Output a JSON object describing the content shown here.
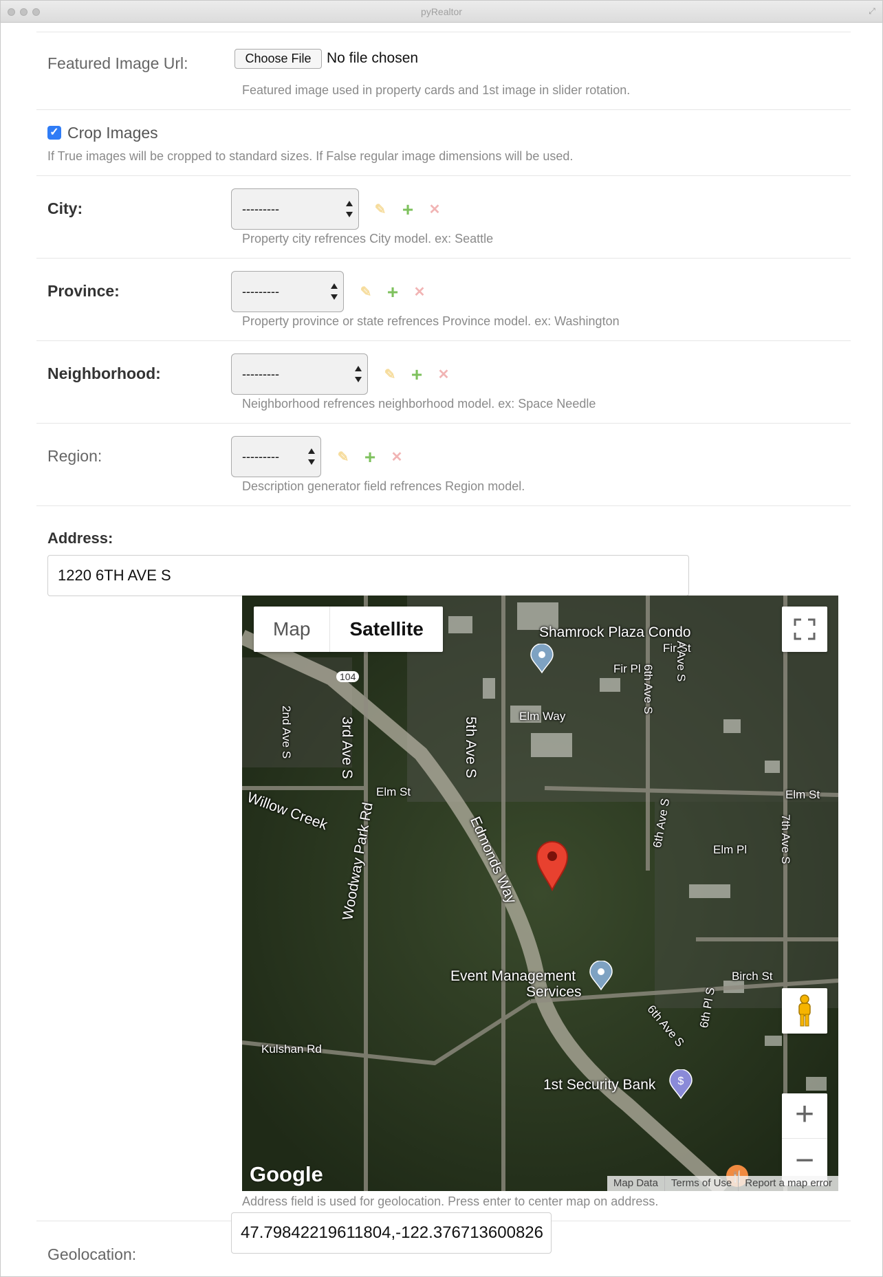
{
  "window": {
    "title": "pyRealtor"
  },
  "featured_image": {
    "label": "Featured Image Url:",
    "choose_button": "Choose File",
    "file_status": "No file chosen",
    "help": "Featured image used in property cards and 1st image in slider rotation."
  },
  "crop_images": {
    "label": "Crop Images",
    "checked": true,
    "help": "If True images will be cropped to standard sizes. If False regular image dimensions will be used."
  },
  "city": {
    "label": "City:",
    "value": "---------",
    "help": "Property city refrences City model. ex: Seattle"
  },
  "province": {
    "label": "Province:",
    "value": "---------",
    "help": "Property province or state refrences Province model. ex: Washington"
  },
  "neighborhood": {
    "label": "Neighborhood:",
    "value": "---------",
    "help": "Neighborhood refrences neighborhood model. ex: Space Needle"
  },
  "region": {
    "label": "Region:",
    "value": "---------",
    "help": "Description generator field refrences Region model."
  },
  "address": {
    "label": "Address:",
    "value": "1220 6TH AVE S",
    "help": "Address field is used for geolocation. Press enter to center map on address."
  },
  "map": {
    "type_map": "Map",
    "type_satellite": "Satellite",
    "zoom_in": "+",
    "zoom_out": "−",
    "google": "Google",
    "attribution": [
      "Map Data",
      "Terms of Use",
      "Report a map error"
    ],
    "labels": {
      "shamrock": "Shamrock Plaza Condo",
      "fir_st": "Fir St",
      "fir_pl": "Fir Pl",
      "a_ave": "A Ave S",
      "sixth_ave_top": "6th Ave S",
      "route": "104",
      "second_ave": "2nd Ave S",
      "third_ave": "3rd Ave S",
      "elm_way": "Elm Way",
      "fifth_ave": "5th Ave S",
      "elm_st_left": "Elm St",
      "elm_st_right": "Elm St",
      "willow_creek": "Willow Creek",
      "woodway": "Woodway Park Rd",
      "edmonds_way": "Edmonds Way",
      "sixth_ave_mid": "6th Ave S",
      "elm_pl": "Elm Pl",
      "seventh_ave": "7th Ave S",
      "event_mgmt_1": "Event Management",
      "event_mgmt_2": "Services",
      "birch_st": "Birch St",
      "sixth_pl": "6th Pl S",
      "sixth_ave_low": "6th Ave S",
      "kulshan": "Kulshan Rd",
      "security_bank": "1st Security Bank"
    }
  },
  "geolocation": {
    "label": "Geolocation:",
    "value": "47.79842219611804,-122.376713600826"
  }
}
